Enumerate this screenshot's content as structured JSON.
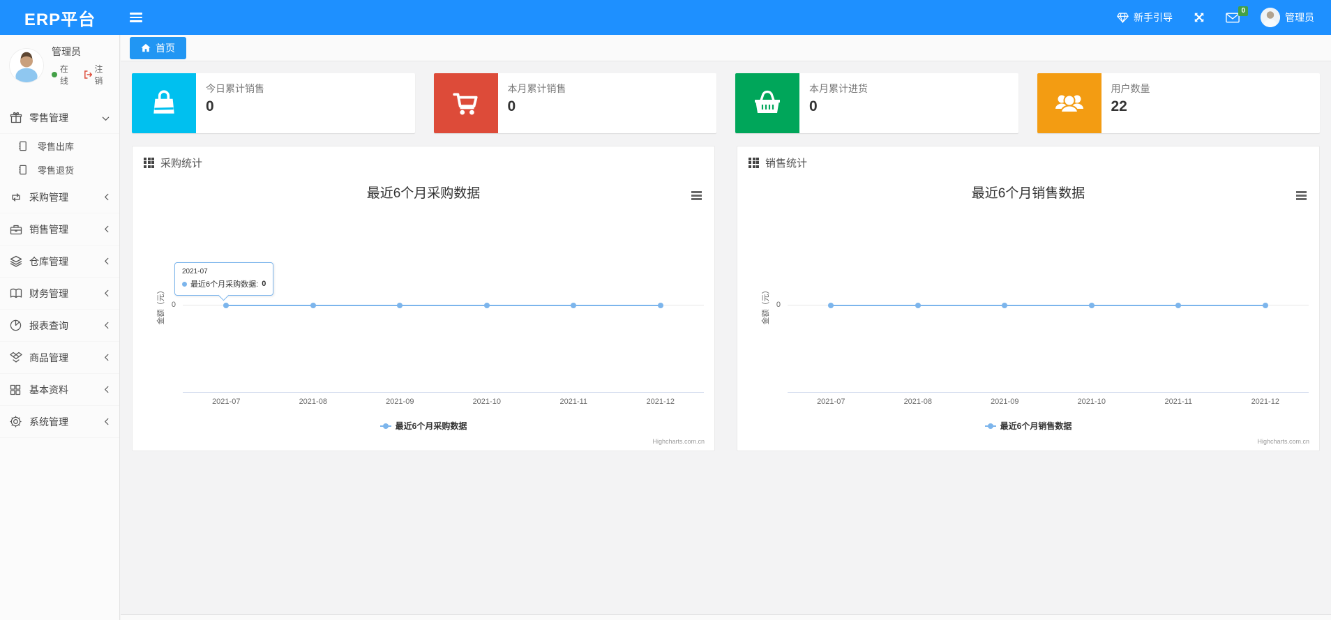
{
  "navbar": {
    "logo": "ERP平台",
    "guide_label": "新手引导",
    "mail_badge": "0",
    "user_label": "管理员"
  },
  "breadcrumb": {
    "home_tab": "首页"
  },
  "sidebar": {
    "user": {
      "name": "管理员",
      "status_label": "在线",
      "logout_label": "注销"
    },
    "items": [
      {
        "label": "零售管理",
        "icon": "gift-icon",
        "state": "expanded",
        "children": [
          {
            "label": "零售出库"
          },
          {
            "label": "零售退货"
          }
        ]
      },
      {
        "label": "采购管理",
        "icon": "repeat-icon"
      },
      {
        "label": "销售管理",
        "icon": "briefcase-icon"
      },
      {
        "label": "仓库管理",
        "icon": "layers-icon"
      },
      {
        "label": "财务管理",
        "icon": "book-icon"
      },
      {
        "label": "报表查询",
        "icon": "pie-chart-icon"
      },
      {
        "label": "商品管理",
        "icon": "dropbox-icon"
      },
      {
        "label": "基本资料",
        "icon": "grid-icon"
      },
      {
        "label": "系统管理",
        "icon": "gear-icon"
      }
    ]
  },
  "cards": [
    {
      "label": "今日累计销售",
      "value": "0",
      "accent": "#00c0ef",
      "icon": "shopping-bag-icon"
    },
    {
      "label": "本月累计销售",
      "value": "0",
      "accent": "#dd4b39",
      "icon": "shopping-cart-icon"
    },
    {
      "label": "本月累计进货",
      "value": "0",
      "accent": "#00a65a",
      "icon": "shopping-basket-icon"
    },
    {
      "label": "用户数量",
      "value": "22",
      "accent": "#f39c12",
      "icon": "users-icon"
    }
  ],
  "panels": [
    {
      "title": "采购统计"
    },
    {
      "title": "销售统计"
    }
  ],
  "chart_data": [
    {
      "type": "line",
      "title": "最近6个月采购数据",
      "categories": [
        "2021-07",
        "2021-08",
        "2021-09",
        "2021-10",
        "2021-11",
        "2021-12"
      ],
      "series": [
        {
          "name": "最近6个月采购数据",
          "values": [
            0,
            0,
            0,
            0,
            0,
            0
          ]
        }
      ],
      "ylabel": "金额（元）",
      "yticks": [
        "0"
      ],
      "ylim": [
        0,
        1
      ],
      "line_color": "#7cb5ec",
      "legend_position": "bottom",
      "grid": "zero-line-only",
      "credits": "Highcharts.com.cn",
      "tooltip": {
        "visible": true,
        "header": "2021-07",
        "label": "最近6个月采购数据:",
        "value": "0"
      }
    },
    {
      "type": "line",
      "title": "最近6个月销售数据",
      "categories": [
        "2021-07",
        "2021-08",
        "2021-09",
        "2021-10",
        "2021-11",
        "2021-12"
      ],
      "series": [
        {
          "name": "最近6个月销售数据",
          "values": [
            0,
            0,
            0,
            0,
            0,
            0
          ]
        }
      ],
      "ylabel": "金额（元）",
      "yticks": [
        "0"
      ],
      "ylim": [
        0,
        1
      ],
      "line_color": "#7cb5ec",
      "legend_position": "bottom",
      "grid": "zero-line-only",
      "credits": "Highcharts.com.cn",
      "tooltip": {
        "visible": false
      }
    }
  ]
}
